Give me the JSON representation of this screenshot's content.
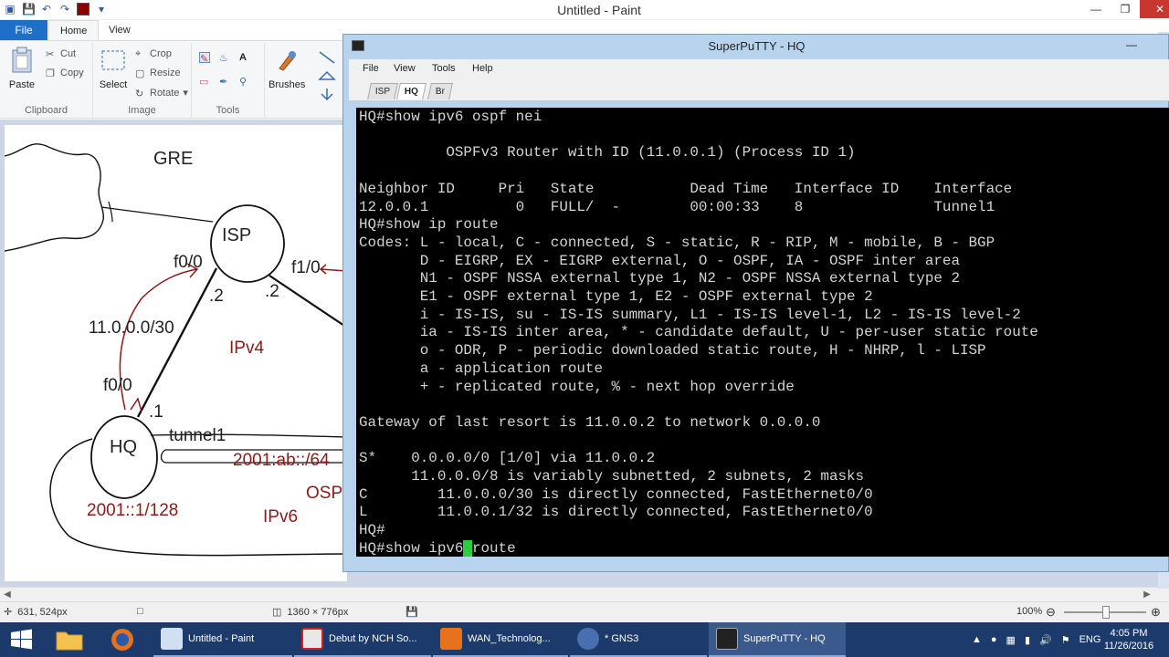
{
  "paint": {
    "window_title": "Untitled - Paint",
    "tabs": {
      "file": "File",
      "home": "Home",
      "view": "View"
    },
    "ribbon": {
      "clipboard": {
        "group": "Clipboard",
        "paste": "Paste",
        "cut": "Cut",
        "copy": "Copy"
      },
      "image": {
        "group": "Image",
        "select": "Select",
        "crop": "Crop",
        "resize": "Resize",
        "rotate": "Rotate"
      },
      "tools": {
        "group": "Tools"
      },
      "brushes": "Brushes"
    },
    "diagram": {
      "gre": "GRE",
      "isp": "ISP",
      "hq": "HQ",
      "f00_top": "f0/0",
      "f10": "f1/0",
      "dot2_a": ".2",
      "dot2_b": ".2",
      "subnet": "11.0.0.0/30",
      "ipv4": "IPv4",
      "f00_bottom": "f0/0",
      "dot1": ".1",
      "tunnel": "tunnel1",
      "ipv6_prefix": "2001:ab::/64",
      "osp": "OSP",
      "loopback": "2001::1/128",
      "ipv6": "IPv6"
    },
    "status": {
      "cursor_pos": "631, 524px",
      "canvas_size": "1360 × 776px",
      "zoom": "100%"
    }
  },
  "putty": {
    "window_title": "SuperPuTTY - HQ",
    "menu": {
      "file": "File",
      "view": "View",
      "tools": "Tools",
      "help": "Help"
    },
    "tabs": [
      "ISP",
      "HQ",
      "Br"
    ],
    "active_tab": "HQ",
    "terminal": {
      "lines": [
        "HQ#show ipv6 ospf nei",
        "",
        "          OSPFv3 Router with ID (11.0.0.1) (Process ID 1)",
        "",
        "Neighbor ID     Pri   State           Dead Time   Interface ID    Interface",
        "12.0.0.1          0   FULL/  -        00:00:33    8               Tunnel1",
        "HQ#show ip route",
        "Codes: L - local, C - connected, S - static, R - RIP, M - mobile, B - BGP",
        "       D - EIGRP, EX - EIGRP external, O - OSPF, IA - OSPF inter area",
        "       N1 - OSPF NSSA external type 1, N2 - OSPF NSSA external type 2",
        "       E1 - OSPF external type 1, E2 - OSPF external type 2",
        "       i - IS-IS, su - IS-IS summary, L1 - IS-IS level-1, L2 - IS-IS level-2",
        "       ia - IS-IS inter area, * - candidate default, U - per-user static route",
        "       o - ODR, P - periodic downloaded static route, H - NHRP, l - LISP",
        "       a - application route",
        "       + - replicated route, % - next hop override",
        "",
        "Gateway of last resort is 11.0.0.2 to network 0.0.0.0",
        "",
        "S*    0.0.0.0/0 [1/0] via 11.0.0.2",
        "      11.0.0.0/8 is variably subnetted, 2 subnets, 2 masks",
        "C        11.0.0.0/30 is directly connected, FastEthernet0/0",
        "L        11.0.0.1/32 is directly connected, FastEthernet0/0",
        "HQ#"
      ],
      "prompt_before_cursor": "HQ#show ipv6",
      "prompt_after_cursor": "route"
    }
  },
  "taskbar": {
    "apps": [
      {
        "label": "Untitled - Paint"
      },
      {
        "label": "Debut by NCH So..."
      },
      {
        "label": "WAN_Technolog..."
      },
      {
        "label": "* GNS3"
      },
      {
        "label": "SuperPuTTY - HQ"
      }
    ],
    "lang": "ENG",
    "time": "4:05 PM",
    "date": "11/26/2016"
  },
  "colors": {
    "putty_frame": "#b8d3ee",
    "terminal_bg": "#000000",
    "cursor": "#2ecc40",
    "diagram_red": "#8b1a1a",
    "taskbar": "#1c3a6b"
  }
}
